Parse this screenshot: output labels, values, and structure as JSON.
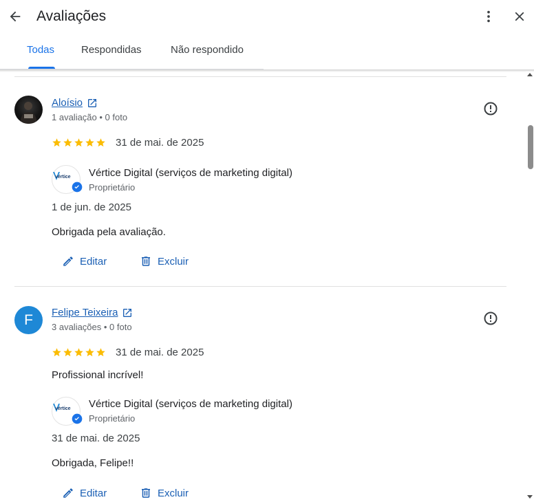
{
  "header": {
    "title": "Avaliações"
  },
  "tabs": [
    {
      "label": "Todas",
      "active": true
    },
    {
      "label": "Respondidas",
      "active": false
    },
    {
      "label": "Não respondido",
      "active": false
    }
  ],
  "colors": {
    "accent": "#1a73e8",
    "star": "#fbbc04",
    "link": "#1a5fb4",
    "avatar_letter_bg": "#1e88d6"
  },
  "reviews": [
    {
      "name": "Aloísio",
      "meta": "1 avaliação • 0 foto",
      "stars": 5,
      "date": "31 de mai. de 2025",
      "comment": "",
      "reply": {
        "owner_name": "Vértice Digital (serviços de marketing digital)",
        "role": "Proprietário",
        "date": "1 de jun. de 2025",
        "text": "Obrigada pela avaliação.",
        "logo_text": "vértice"
      },
      "actions": {
        "edit": "Editar",
        "delete": "Excluir"
      }
    },
    {
      "name": "Felipe Teixeira",
      "avatar_letter": "F",
      "meta": "3 avaliações • 0 foto",
      "stars": 5,
      "date": "31 de mai. de 2025",
      "comment": "Profissional incrível!",
      "reply": {
        "owner_name": "Vértice Digital (serviços de marketing digital)",
        "role": "Proprietário",
        "date": "31 de mai. de 2025",
        "text": "Obrigada, Felipe!!",
        "logo_text": "vértice"
      },
      "actions": {
        "edit": "Editar",
        "delete": "Excluir"
      }
    }
  ]
}
